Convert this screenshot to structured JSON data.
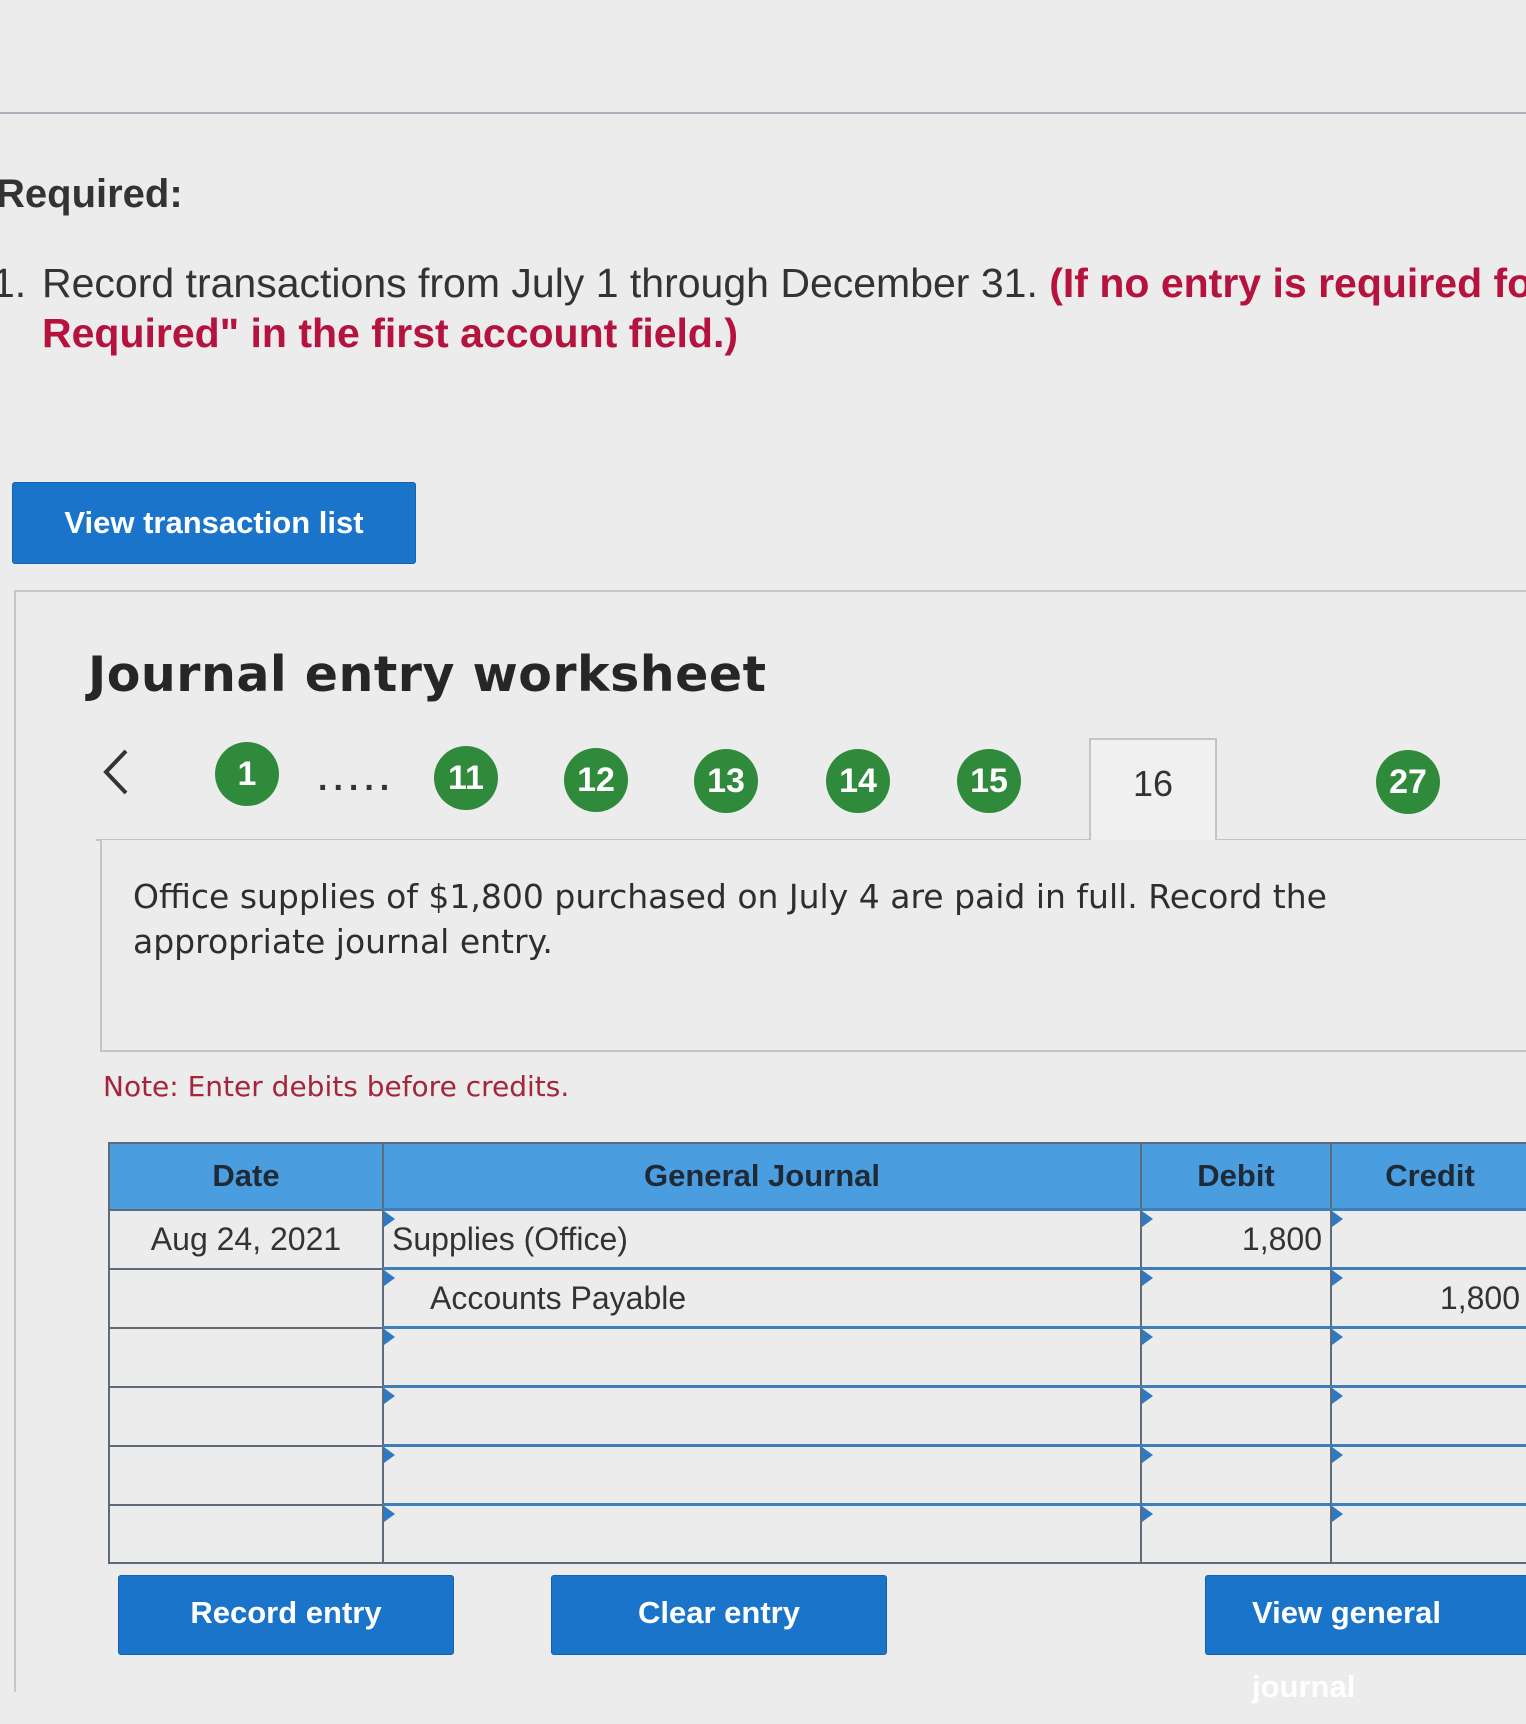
{
  "required_heading": "Required:",
  "instruction": {
    "number": "1.",
    "text": "Record transactions from July 1 through December 31.",
    "highlight_line1": "(If no entry is required for a",
    "highlight_line2": "Required\" in the first account field.)"
  },
  "view_transaction_list_label": "View transaction list",
  "worksheet": {
    "title": "Journal entry worksheet",
    "prev_icon": "chevron-left-icon",
    "steps": [
      "1",
      "11",
      "12",
      "13",
      "14",
      "15",
      "27"
    ],
    "ellipsis": ".....",
    "active_step": "16",
    "question": "Office supplies of $1,800 purchased on July 4 are paid in full. Record the appropriate journal entry.",
    "note": "Note: Enter debits before credits."
  },
  "journal": {
    "headers": [
      "Date",
      "General Journal",
      "Debit",
      "Credit"
    ],
    "rows": [
      {
        "date": "Aug 24, 2021",
        "account": "Supplies (Office)",
        "debit": "1,800",
        "credit": ""
      },
      {
        "date": "",
        "account": "Accounts Payable",
        "debit": "",
        "credit": "1,800"
      },
      {
        "date": "",
        "account": "",
        "debit": "",
        "credit": ""
      },
      {
        "date": "",
        "account": "",
        "debit": "",
        "credit": ""
      },
      {
        "date": "",
        "account": "",
        "debit": "",
        "credit": ""
      },
      {
        "date": "",
        "account": "",
        "debit": "",
        "credit": ""
      }
    ]
  },
  "buttons": {
    "record_entry": "Record entry",
    "clear_entry": "Clear entry",
    "view_general_journal": "View general journal"
  },
  "colors": {
    "accent_blue": "#1a74c9",
    "header_blue": "#4a9ee0",
    "step_green": "#2f8a3c",
    "highlight_red": "#b5123e"
  }
}
